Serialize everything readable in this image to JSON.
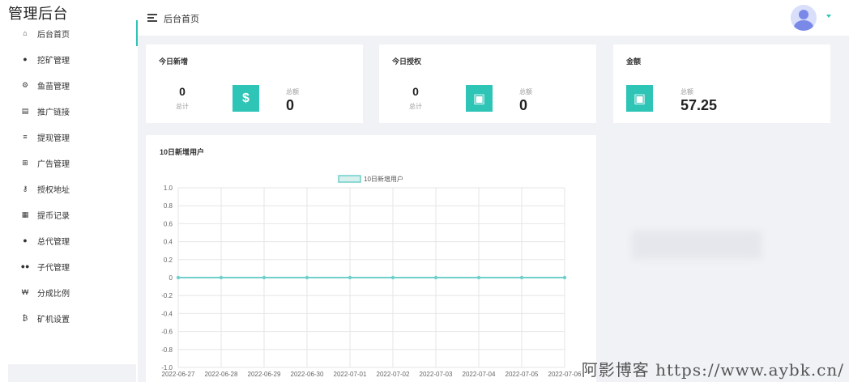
{
  "app": {
    "title": "管理后台"
  },
  "sidebar": {
    "items": [
      {
        "label": "后台首页",
        "icon": "home-icon",
        "glyph": "⌂"
      },
      {
        "label": "挖矿管理",
        "icon": "user-icon",
        "glyph": "●"
      },
      {
        "label": "鱼苗管理",
        "icon": "fish-icon",
        "glyph": "⚙"
      },
      {
        "label": "推广链接",
        "icon": "file-icon",
        "glyph": "▤"
      },
      {
        "label": "提现管理",
        "icon": "list-icon",
        "glyph": "≡"
      },
      {
        "label": "广告管理",
        "icon": "grid-icon",
        "glyph": "⊞"
      },
      {
        "label": "授权地址",
        "icon": "key-icon",
        "glyph": "⚷"
      },
      {
        "label": "提币记录",
        "icon": "record-icon",
        "glyph": "▦"
      },
      {
        "label": "总代管理",
        "icon": "user-icon",
        "glyph": "●"
      },
      {
        "label": "子代管理",
        "icon": "users-icon",
        "glyph": "●●"
      },
      {
        "label": "分成比例",
        "icon": "won-icon",
        "glyph": "₩"
      },
      {
        "label": "矿机设置",
        "icon": "bitcoin-icon",
        "glyph": "₿"
      }
    ]
  },
  "header": {
    "breadcrumb": "后台首页"
  },
  "cards": {
    "today_new": {
      "title": "今日新增",
      "count": "0",
      "count_label": "总计",
      "total_label": "总额",
      "total": "0",
      "icon_glyph": "$"
    },
    "today_auth": {
      "title": "今日授权",
      "count": "0",
      "count_label": "总计",
      "total_label": "总额",
      "total": "0",
      "icon_glyph": "▣"
    },
    "amount": {
      "title": "金额",
      "total_label": "总额",
      "total": "57.25",
      "icon_glyph": "▣"
    }
  },
  "colors": {
    "accent": "#2ec4b6",
    "line": "#6fcfca"
  },
  "chart_data": {
    "type": "line",
    "title": "10日新增用户",
    "x": [
      "2022-06-27",
      "2022-06-28",
      "2022-06-29",
      "2022-06-30",
      "2022-07-01",
      "2022-07-02",
      "2022-07-03",
      "2022-07-04",
      "2022-07-05",
      "2022-07-06"
    ],
    "series": [
      {
        "name": "10日新增用户",
        "values": [
          0,
          0,
          0,
          0,
          0,
          0,
          0,
          0,
          0,
          0
        ]
      }
    ],
    "ylim": [
      -1.0,
      1.0
    ],
    "yticks": [
      "1.0",
      "0.8",
      "0.6",
      "0.4",
      "0.2",
      "0",
      "-0.2",
      "-0.4",
      "-0.6",
      "-0.8",
      "-1.0"
    ],
    "grid": true,
    "legend": "top-center"
  },
  "watermark": "阿影博客 https://www.aybk.cn/"
}
